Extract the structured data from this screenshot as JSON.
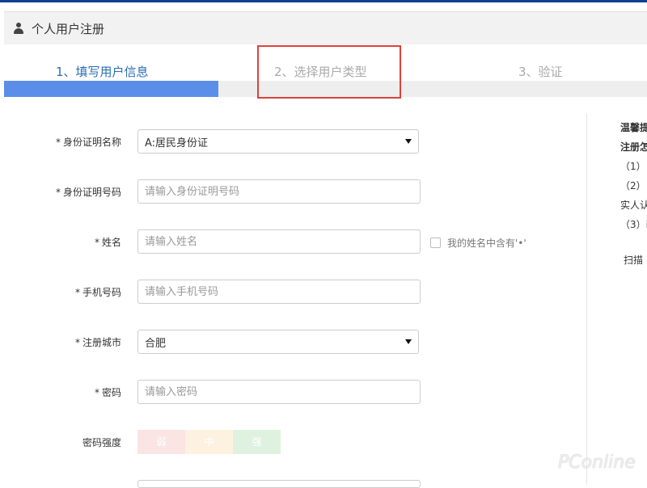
{
  "header": {
    "title": "个人用户注册",
    "icon": "user-icon"
  },
  "steps": [
    {
      "label": "1、填写用户信息"
    },
    {
      "label": "2、选择用户类型"
    },
    {
      "label": "3、验证"
    }
  ],
  "progress": {
    "completed_fraction": 0.333
  },
  "form": {
    "id_type": {
      "label": "身份证明名称",
      "required_mark": "*",
      "value": "A:居民身份证"
    },
    "id_number": {
      "label": "身份证明号码",
      "required_mark": "*",
      "placeholder": "请输入身份证明号码"
    },
    "name": {
      "label": "姓名",
      "required_mark": "*",
      "placeholder": "请输入姓名",
      "checkbox_label": "我的姓名中含有'•'"
    },
    "phone": {
      "label": "手机号码",
      "required_mark": "*",
      "placeholder": "请输入手机号码"
    },
    "city": {
      "label": "注册城市",
      "required_mark": "*",
      "value": "合肥"
    },
    "password": {
      "label": "密码",
      "required_mark": "*",
      "placeholder": "请输入密码"
    },
    "strength": {
      "label": "密码强度",
      "weak": "弱",
      "medium": "中",
      "strong": "强"
    }
  },
  "tips": {
    "line1": "温馨提",
    "line2": "注册怎",
    "line3": "（1）:",
    "line4": "（2）:",
    "line5": "实人认",
    "line6": "（3）i",
    "line7": "扫描"
  },
  "watermark": {
    "text": "PConline"
  }
}
